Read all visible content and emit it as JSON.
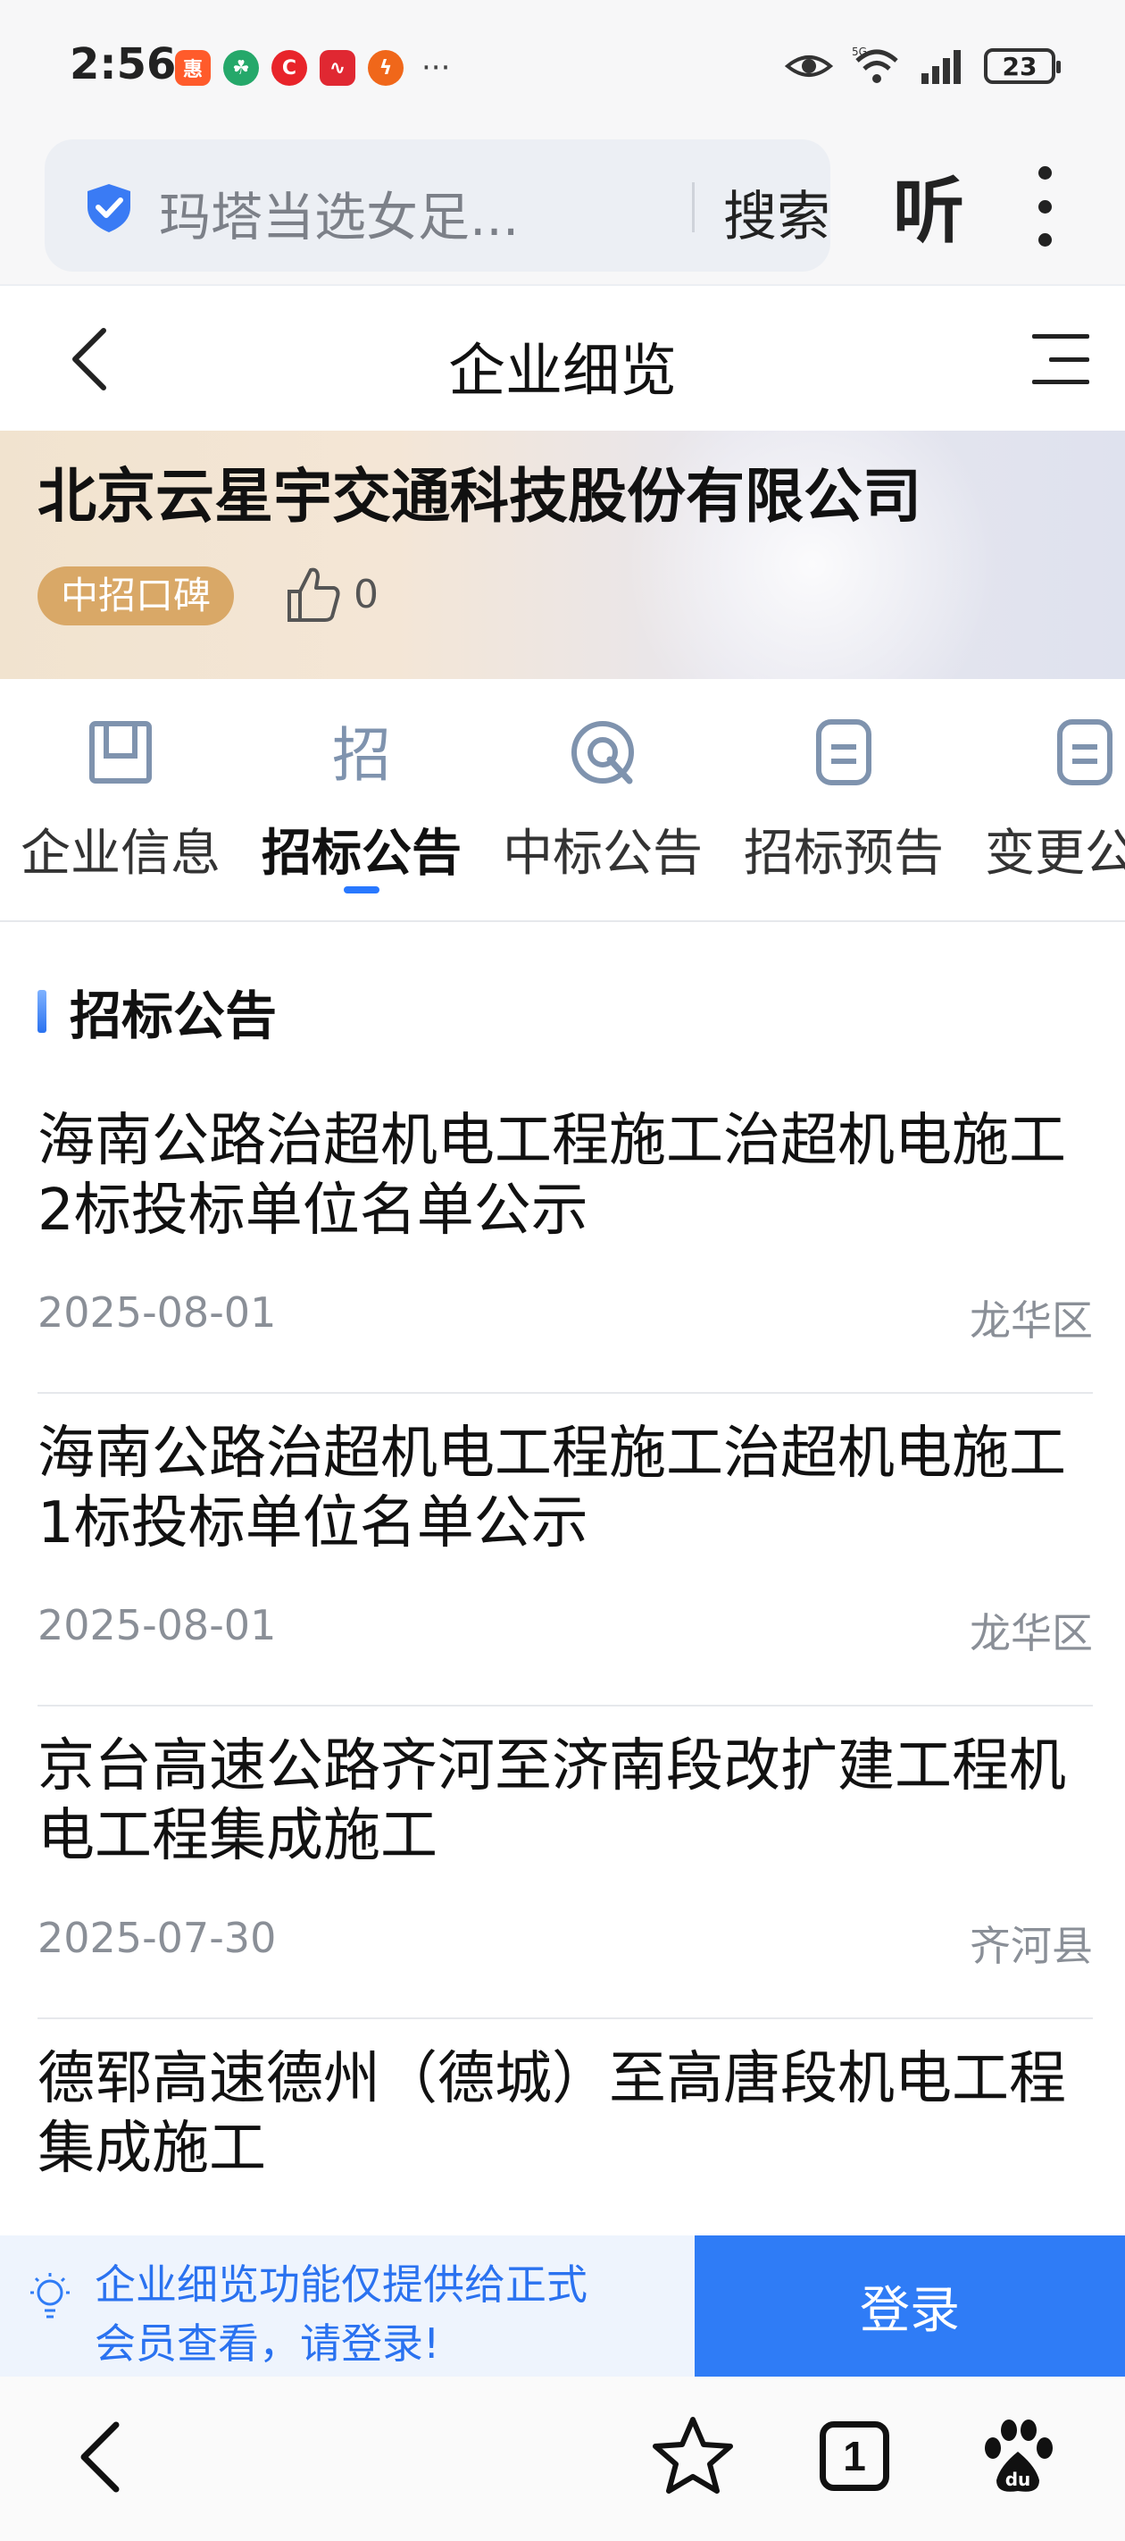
{
  "status_bar": {
    "time": "2:56",
    "battery": "23",
    "network": "5G",
    "notification_icons": [
      {
        "name": "shopping-app-icon",
        "color": "#ff5b2b"
      },
      {
        "name": "leaf-app-icon",
        "color": "#25a86a"
      },
      {
        "name": "c-app-icon",
        "color": "#e8242a"
      },
      {
        "name": "chart-app-icon",
        "color": "#e02832"
      },
      {
        "name": "lightning-app-icon",
        "color": "#f0671a"
      }
    ],
    "more_indicator": "···"
  },
  "browser": {
    "search_text": "玛塔当选女足...",
    "search_button": "搜索",
    "listen_button": "听"
  },
  "header": {
    "title": "企业细览"
  },
  "company": {
    "name": "北京云星宇交通科技股份有限公司",
    "reputation_badge": "中招口碑",
    "likes": "0"
  },
  "tabs": [
    {
      "label": "企业信息",
      "icon": "profile-card-icon",
      "active": false
    },
    {
      "label": "招标公告",
      "icon": "bid-invite-icon",
      "active": true
    },
    {
      "label": "中标公告",
      "icon": "target-icon",
      "active": false
    },
    {
      "label": "招标预告",
      "icon": "document-icon",
      "active": false
    },
    {
      "label": "变更公告",
      "icon": "document-icon",
      "active": false
    }
  ],
  "section": {
    "title": "招标公告"
  },
  "notices": [
    {
      "title": "海南公路治超机电工程施工治超机电施工2标投标单位名单公示",
      "date": "2025-08-01",
      "region": "龙华区"
    },
    {
      "title": "海南公路治超机电工程施工治超机电施工1标投标单位名单公示",
      "date": "2025-08-01",
      "region": "龙华区"
    },
    {
      "title": "京台高速公路齐河至济南段改扩建工程机电工程集成施工",
      "date": "2025-07-30",
      "region": "齐河县"
    },
    {
      "title": "德郓高速德州（德城）至高唐段机电工程集成施工",
      "date": "",
      "region": ""
    }
  ],
  "login_prompt": {
    "notice": "企业细览功能仅提供给正式会员查看，请登录!",
    "button": "登录"
  },
  "bottom_nav": {
    "tab_count": "1"
  },
  "colors": {
    "accent": "#2f7cf6",
    "badge": "#d9a867",
    "muted_text": "#8a8f97"
  }
}
